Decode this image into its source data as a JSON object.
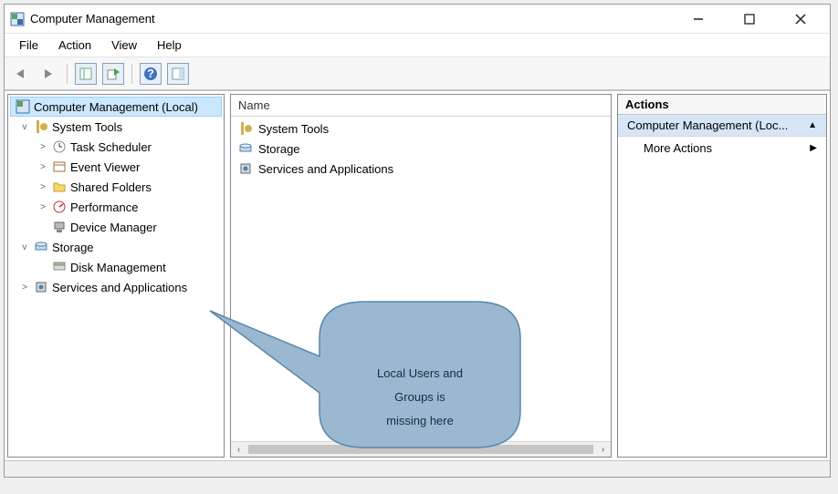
{
  "window_title": "Computer Management",
  "menu": {
    "file": "File",
    "action": "Action",
    "view": "View",
    "help": "Help"
  },
  "tree": {
    "items": [
      {
        "label": "Computer Management (Local)",
        "level": 0,
        "glyph": "",
        "icon": "app",
        "selected": true
      },
      {
        "label": "System Tools",
        "level": 1,
        "glyph": "v",
        "icon": "systools"
      },
      {
        "label": "Task Scheduler",
        "level": 2,
        "glyph": ">",
        "icon": "clock"
      },
      {
        "label": "Event Viewer",
        "level": 2,
        "glyph": ">",
        "icon": "event"
      },
      {
        "label": "Shared Folders",
        "level": 2,
        "glyph": ">",
        "icon": "folder"
      },
      {
        "label": "Performance",
        "level": 2,
        "glyph": ">",
        "icon": "perf"
      },
      {
        "label": "Device Manager",
        "level": 2,
        "glyph": "",
        "icon": "device"
      },
      {
        "label": "Storage",
        "level": 1,
        "glyph": "v",
        "icon": "storage"
      },
      {
        "label": "Disk Management",
        "level": 2,
        "glyph": "",
        "icon": "disk"
      },
      {
        "label": "Services and Applications",
        "level": 1,
        "glyph": ">",
        "icon": "services"
      }
    ]
  },
  "list": {
    "header": "Name",
    "rows": [
      {
        "label": "System Tools",
        "icon": "systools"
      },
      {
        "label": "Storage",
        "icon": "storage"
      },
      {
        "label": "Services and Applications",
        "icon": "services"
      }
    ]
  },
  "actions": {
    "header": "Actions",
    "primary": "Computer Management (Loc...",
    "more": "More Actions"
  },
  "callout_text_l1": "Local Users and",
  "callout_text_l2": "Groups is",
  "callout_text_l3": "missing here"
}
